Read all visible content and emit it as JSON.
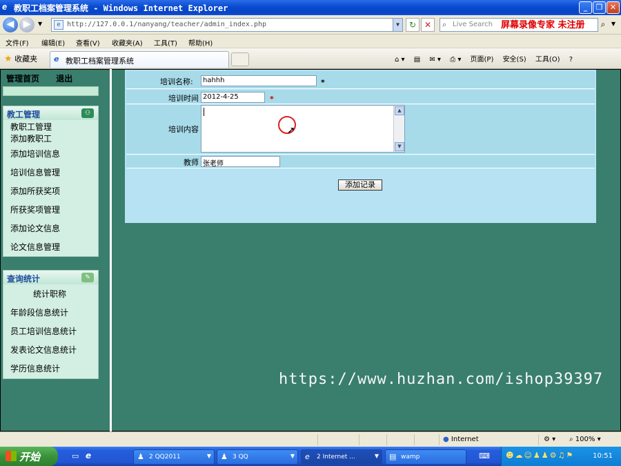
{
  "window": {
    "title": "教职工档案管理系统 - Windows Internet Explorer"
  },
  "address": {
    "url": "http://127.0.0.1/nanyang/teacher/admin_index.php"
  },
  "search": {
    "placeholder": "Live Search",
    "overlay": "屏幕录像专家 未注册"
  },
  "menu": [
    "文件(F)",
    "编辑(E)",
    "查看(V)",
    "收藏夹(A)",
    "工具(T)",
    "帮助(H)"
  ],
  "favorites": {
    "label": "收藏夹"
  },
  "tab": {
    "title": "教职工档案管理系统"
  },
  "toolbar": {
    "page": "页面(P)",
    "safety": "安全(S)",
    "tools": "工具(O)"
  },
  "topnav": {
    "home": "管理首页",
    "logout": "退出"
  },
  "panel1": {
    "title": "教工管理",
    "items": [
      "教职工管理",
      "添加教职工",
      "添加培训信息",
      "培训信息管理",
      "添加所获奖项",
      "所获奖项管理",
      "添加论文信息",
      "论文信息管理"
    ]
  },
  "panel2": {
    "title": "查询统计",
    "items": [
      "统计职称",
      "年龄段信息统计",
      "员工培训信息统计",
      "发表论文信息统计",
      "学历信息统计"
    ]
  },
  "form": {
    "name_label": "培训名称:",
    "name_value": "hahhh",
    "time_label": "培训时间",
    "time_value": "2012-4-25",
    "content_label": "培训内容",
    "teacher_label": "教师",
    "teacher_value": "张老师",
    "submit": "添加记录",
    "required_mark": "*"
  },
  "watermark": "https://www.huzhan.com/ishop39397",
  "status": {
    "zone": "Internet",
    "zoom": "100%"
  },
  "taskbar": {
    "start": "开始",
    "buttons": [
      "2 QQ2011",
      "3 QQ",
      "2 Internet ...",
      "wamp"
    ],
    "clock": "10:51"
  }
}
